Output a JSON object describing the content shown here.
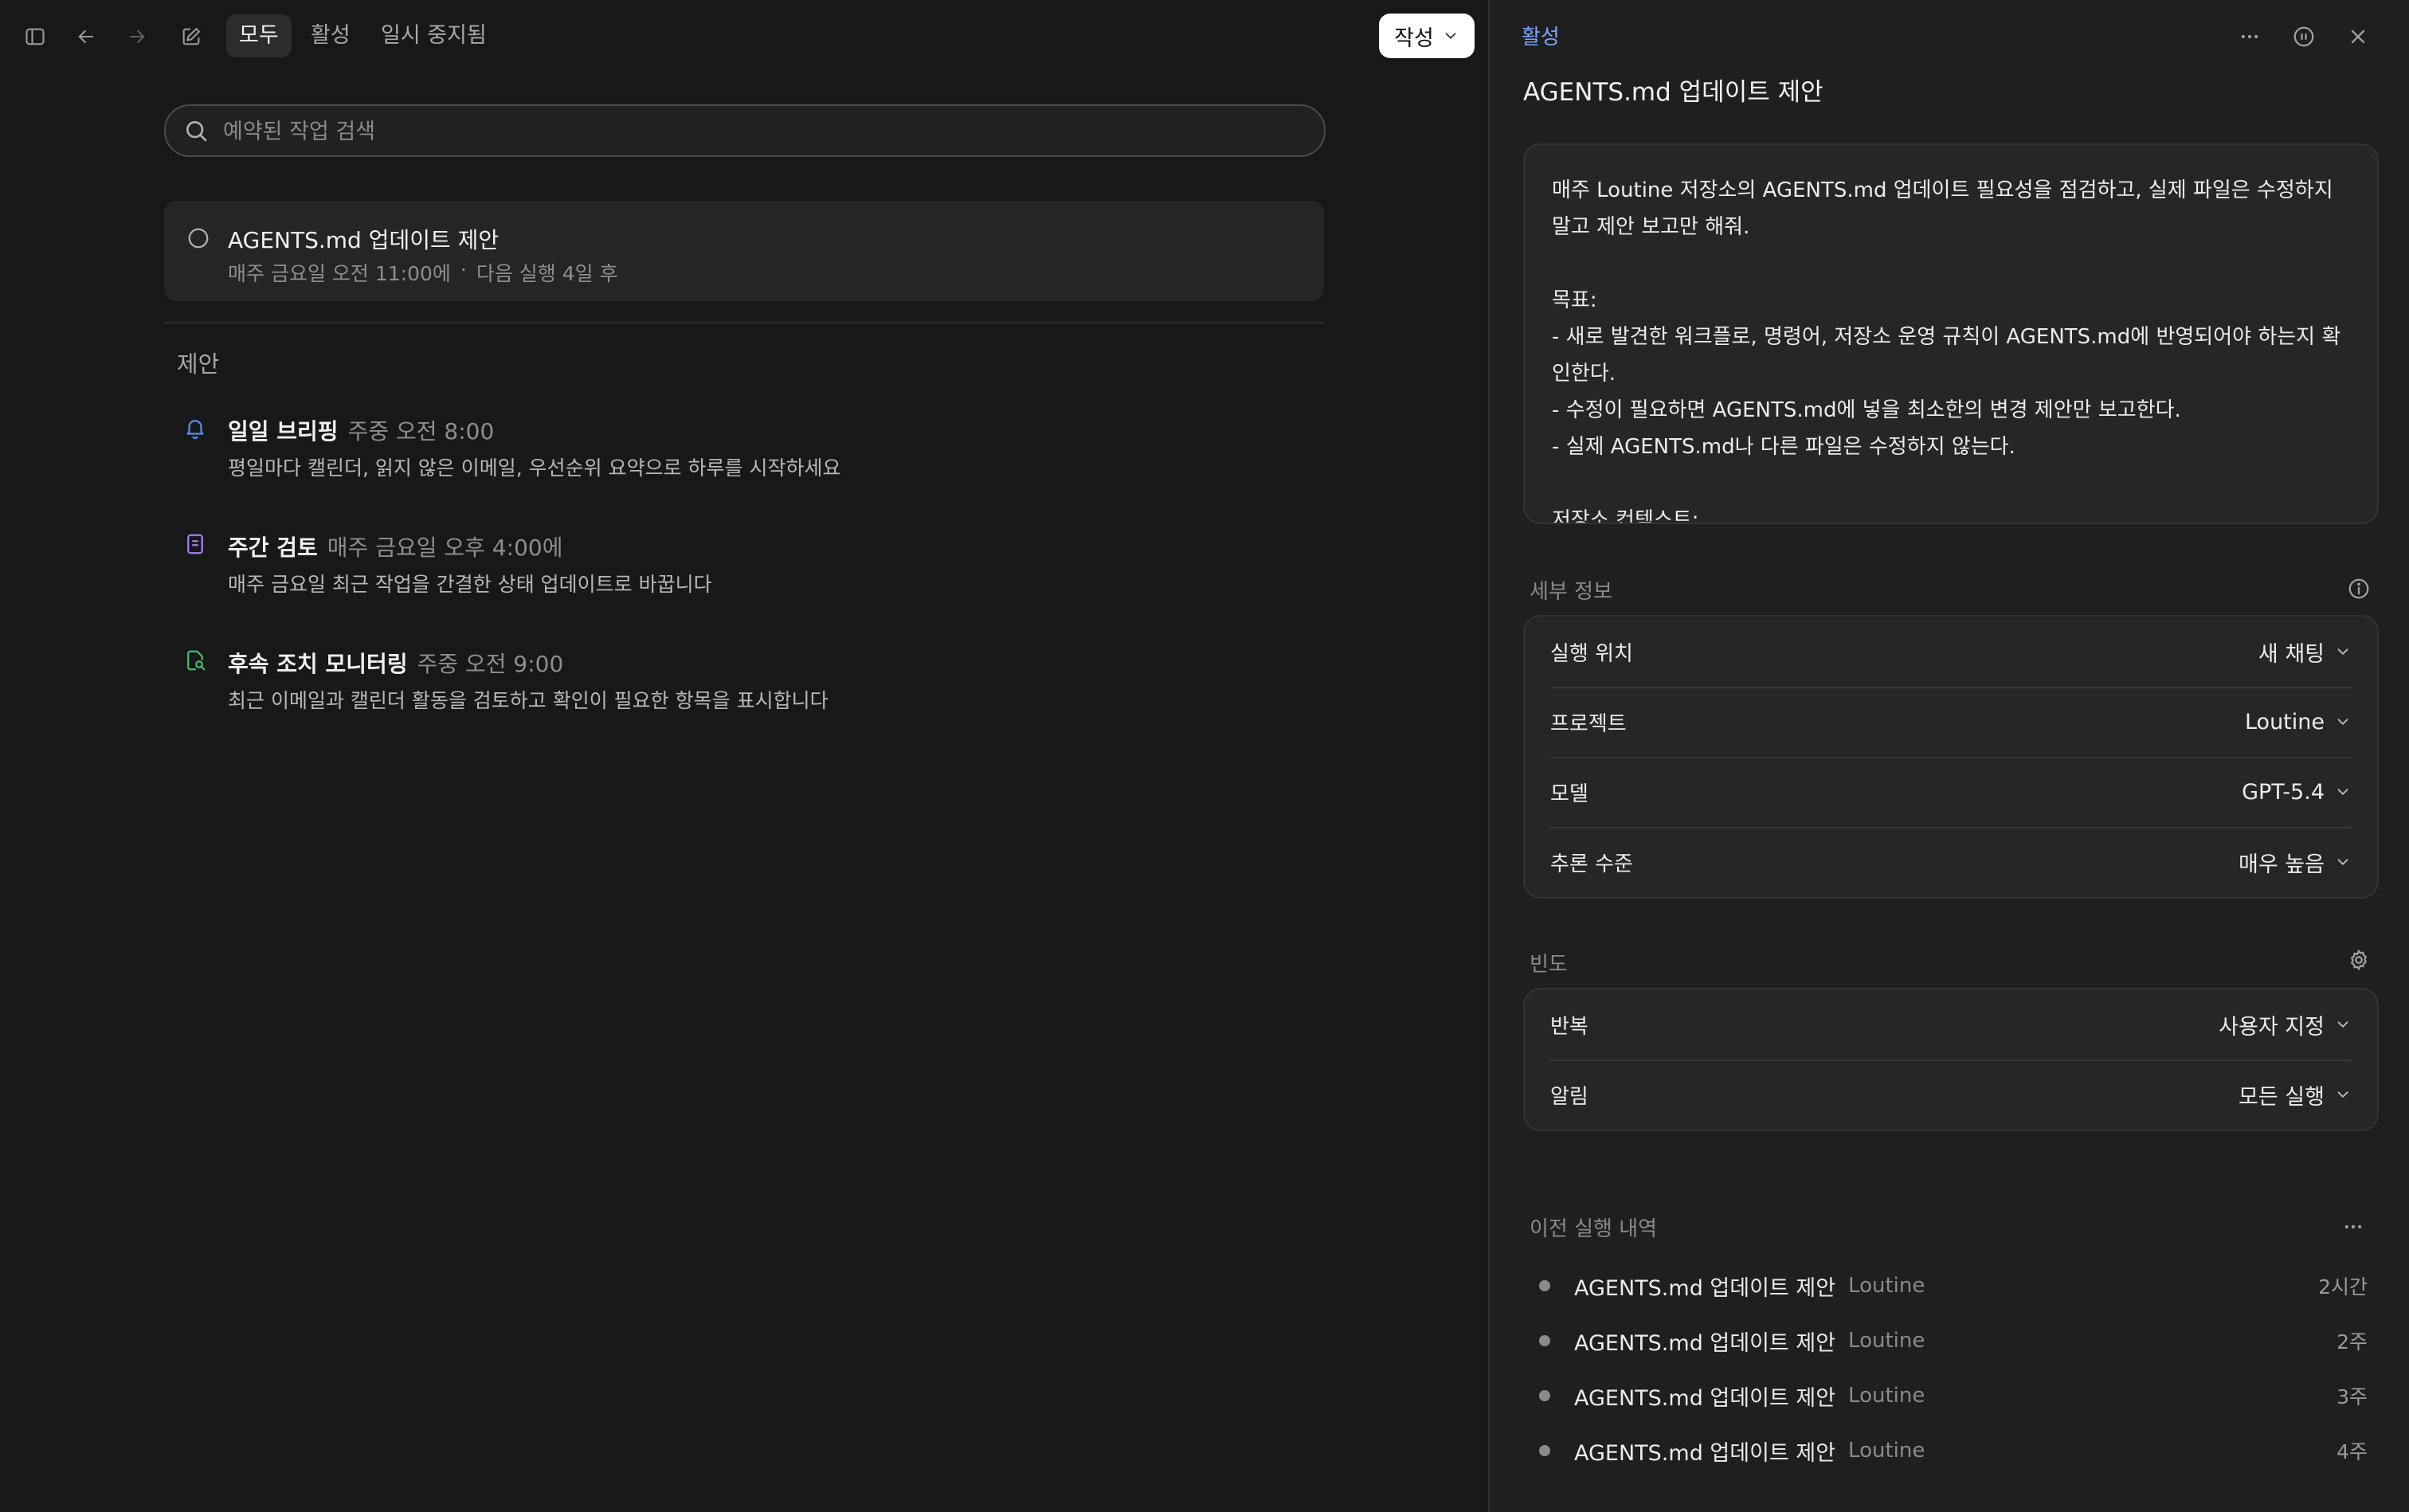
{
  "toolbar": {
    "tabs": [
      "모두",
      "활성",
      "일시 중지됨"
    ],
    "compose_label": "작성"
  },
  "search": {
    "placeholder": "예약된 작업 검색"
  },
  "task": {
    "title": "AGENTS.md 업데이트 제안",
    "schedule": "매주 금요일 오전 11:00에",
    "separator": "·",
    "next_run": "다음 실행 4일 후"
  },
  "suggestions": {
    "title": "제안",
    "items": [
      {
        "title": "일일 브리핑",
        "time": "주중 오전 8:00",
        "desc": "평일마다 캘린더, 읽지 않은 이메일, 우선순위 요약으로 하루를 시작하세요",
        "icon": "bell-icon",
        "color": "#5b8def"
      },
      {
        "title": "주간 검토",
        "time": "매주 금요일 오후 4:00에",
        "desc": "매주 금요일 최근 작업을 간결한 상태 업데이트로 바꿉니다",
        "icon": "document-icon",
        "color": "#a57cf0"
      },
      {
        "title": "후속 조치 모니터링",
        "time": "주중 오전 9:00",
        "desc": "최근 이메일과 캘린더 활동을 검토하고 확인이 필요한 항목을 표시합니다",
        "icon": "search-doc-icon",
        "color": "#3fbf6e"
      }
    ]
  },
  "detail": {
    "status": "활성",
    "title": "AGENTS.md 업데이트 제안",
    "prompt": "매주 Loutine 저장소의 AGENTS.md 업데이트 필요성을 점검하고, 실제 파일은 수정하지 말고 제안 보고만 해줘.\n\n목표:\n- 새로 발견한 워크플로, 명령어, 저장소 운영 규칙이 AGENTS.md에 반영되어야 하는지 확인한다.\n- 수정이 필요하면 AGENTS.md에 넣을 최소한의 변경 제안만 보고한다.\n- 실제 AGENTS.md나 다른 파일은 수정하지 않는다.\n\n저장소 컨텍스트:",
    "details_label": "세부 정보",
    "details": [
      {
        "label": "실행 위치",
        "value": "새 채팅"
      },
      {
        "label": "프로젝트",
        "value": "Loutine"
      },
      {
        "label": "모델",
        "value": "GPT-5.4"
      },
      {
        "label": "추론 수준",
        "value": "매우 높음"
      }
    ],
    "frequency_label": "빈도",
    "frequency": [
      {
        "label": "반복",
        "value": "사용자 지정"
      },
      {
        "label": "알림",
        "value": "모든 실행"
      }
    ],
    "history_label": "이전 실행 내역",
    "history": [
      {
        "title": "AGENTS.md 업데이트 제안",
        "project": "Loutine",
        "when": "2시간"
      },
      {
        "title": "AGENTS.md 업데이트 제안",
        "project": "Loutine",
        "when": "2주"
      },
      {
        "title": "AGENTS.md 업데이트 제안",
        "project": "Loutine",
        "when": "3주"
      },
      {
        "title": "AGENTS.md 업데이트 제안",
        "project": "Loutine",
        "when": "4주"
      }
    ]
  },
  "colors": {
    "background": "#181818",
    "panel": "#1f1f1f",
    "accent_link": "#7aa7ff"
  }
}
